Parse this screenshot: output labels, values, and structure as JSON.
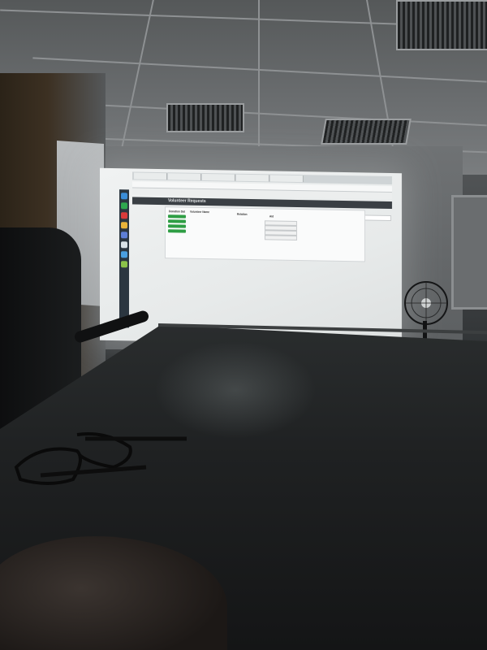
{
  "projection": {
    "app_title": "Volunteer Requests",
    "sidenav": [
      "",
      "",
      ""
    ],
    "columns": [
      "Donation Dat",
      "Volunteer Name",
      "Relation",
      "Aid"
    ],
    "rows": [
      {
        "date": "",
        "name": "",
        "relation": "",
        "aid": ""
      },
      {
        "date": "",
        "name": "",
        "relation": "",
        "aid": ""
      },
      {
        "date": "",
        "name": "",
        "relation": "",
        "aid": ""
      },
      {
        "date": "",
        "name": "",
        "relation": "",
        "aid": ""
      }
    ]
  },
  "colors": {
    "screen": "#eceeee",
    "green_button": "#2e9e44",
    "header_bar": "#3a3f44",
    "taskbar": "#2b3640",
    "table": "#1f2122"
  }
}
